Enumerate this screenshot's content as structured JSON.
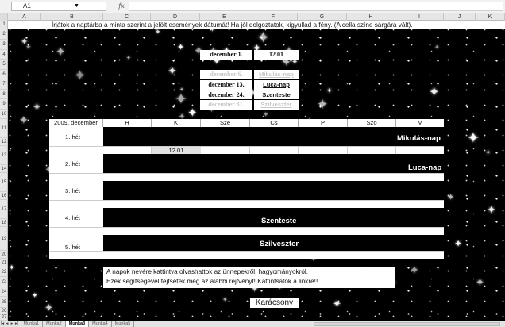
{
  "formula_bar": {
    "cell_ref": "A1",
    "fx": "fx",
    "value": ""
  },
  "columns": [
    "A",
    "B",
    "C",
    "D",
    "E",
    "F",
    "G",
    "H",
    "I",
    "J",
    "K"
  ],
  "rows": [
    "1",
    "2",
    "3",
    "4",
    "5",
    "6",
    "7",
    "8",
    "9",
    "10",
    "11",
    "12",
    "13",
    "14",
    "15",
    "16",
    "17",
    "18",
    "19",
    "20",
    "21",
    "22",
    "23",
    "24",
    "25",
    "26",
    "27"
  ],
  "instruction": "Írjátok a naptárba a minta szerint a jelölt események dátumát! Ha jól dolgoztatok, kigyullad a fény. (A cella színe sárgára vált).",
  "sample": {
    "label": "december 1.",
    "value": "12.01"
  },
  "holidays": [
    {
      "date": "december 6.",
      "name": "Mikulás-nap",
      "highlight": false
    },
    {
      "date": "december 13.",
      "name": "Luca-nap",
      "highlight": true
    },
    {
      "date": "december 24.",
      "name": "Szenteste",
      "highlight": true
    },
    {
      "date": "december 31.",
      "name": "Szilveszter",
      "highlight": false
    }
  ],
  "calendar": {
    "title": "2009. december",
    "days": [
      "H",
      "K",
      "Sze",
      "Cs",
      "P",
      "Szo",
      "V"
    ],
    "weeks": [
      "1. hét",
      "2. hét",
      "3. hét",
      "4. hét",
      "5. hét"
    ],
    "filled_date": "12.01",
    "events": {
      "mikulas": "Mikulás-nap",
      "luca": "Luca-nap",
      "szenteste": "Szenteste",
      "szilveszter": "Szilveszter"
    }
  },
  "note": {
    "line1": "A napok nevére kattintva olvashattok az ünnepekről, hagyományokról.",
    "line2": "Ezek segítségével fejtsétek meg az alábbi rejtvényt! Kattintsatok a linkre!!"
  },
  "link_label": "Karácsony",
  "sheet_tabs": [
    "Munka1",
    "Munka2",
    "Munka3",
    "Munka4",
    "Munka5"
  ],
  "active_tab_index": 2
}
